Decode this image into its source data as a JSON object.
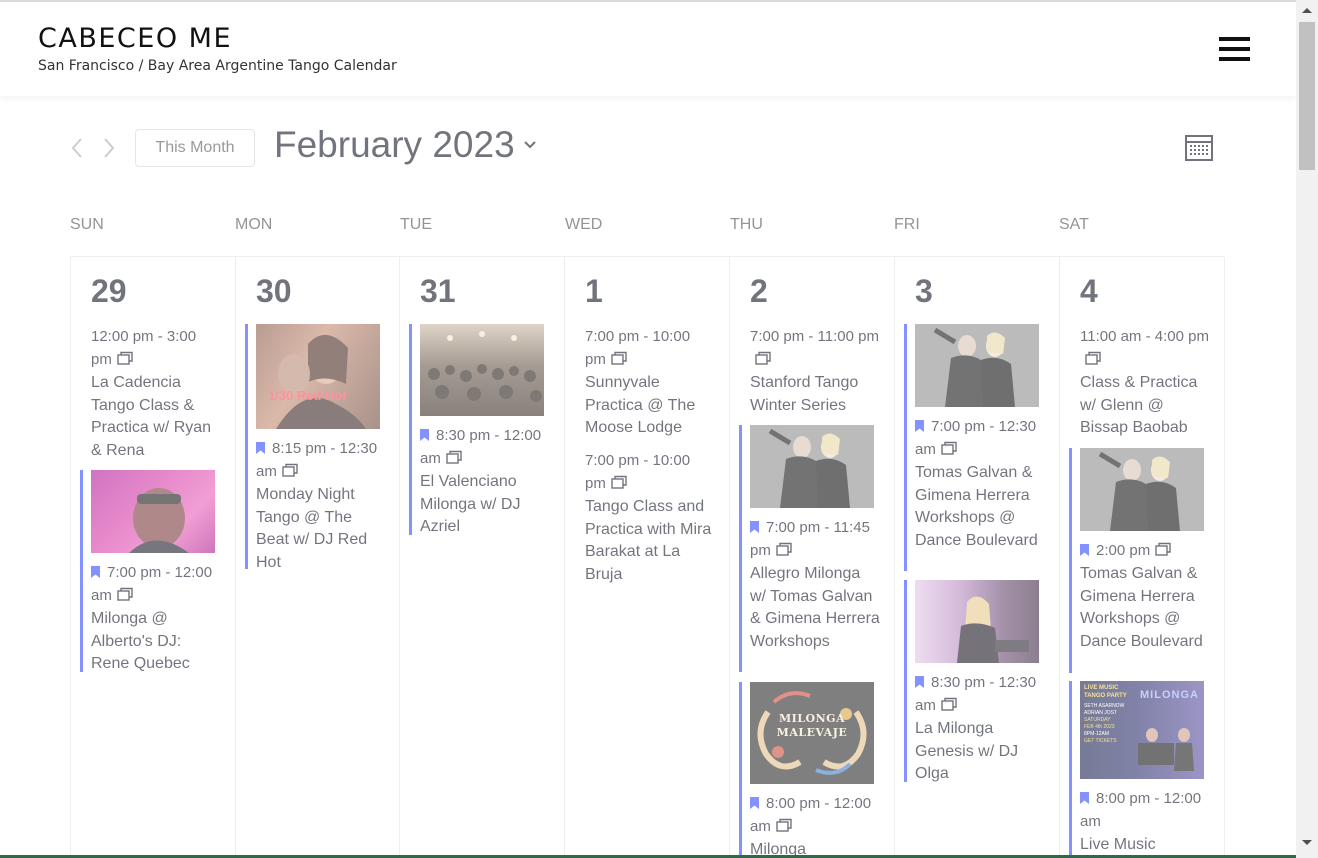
{
  "header": {
    "title": "CABECEO ME",
    "tagline": "San Francisco / Bay Area Argentine Tango Calendar"
  },
  "toolbar": {
    "today_label": "This Month",
    "month_label": "February 2023"
  },
  "weekdays": [
    "SUN",
    "MON",
    "TUE",
    "WED",
    "THU",
    "FRI",
    "SAT"
  ],
  "colors": {
    "accent": "#334aff",
    "text": "#141827",
    "border": "#e4e4e4"
  },
  "days": [
    {
      "num": "29",
      "events": [
        {
          "time": "12:00 pm - 3:00 pm",
          "title": "La Cadencia Tango Class & Practica w/ Ryan & Rena",
          "featured": false
        },
        {
          "time": "7:00 pm - 12:00 am",
          "title": "Milonga @ Alberto's DJ: Rene Quebec",
          "featured": true
        }
      ]
    },
    {
      "num": "30",
      "events": [
        {
          "time": "8:15 pm - 12:30 am",
          "title": "Monday Night Tango @ The Beat w/ DJ Red Hot",
          "featured": true,
          "img_caption": "1/30 Red Hot"
        }
      ]
    },
    {
      "num": "31",
      "events": [
        {
          "time": "8:30 pm - 12:00 am",
          "title": "El Valenciano Milonga w/ DJ Azriel",
          "featured": true
        }
      ]
    },
    {
      "num": "1",
      "events": [
        {
          "time": "7:00 pm - 10:00 pm",
          "title": "Sunnyvale Practica @ The Moose Lodge",
          "featured": false
        },
        {
          "time": "7:00 pm - 10:00 pm",
          "title": "Tango Class and Practica with Mira Barakat at La Bruja",
          "featured": false
        }
      ]
    },
    {
      "num": "2",
      "events": [
        {
          "time": "7:00 pm - 11:00 pm",
          "title": "Stanford Tango Winter Series",
          "featured": false
        },
        {
          "time": "7:00 pm - 11:45 pm",
          "title": "Allegro Milonga w/ Tomas Galvan & Gimena Herrera Workshops",
          "featured": true
        },
        {
          "time": "8:00 pm - 12:00 am",
          "title": "Milonga",
          "featured": true,
          "img_caption": "MILONGA MALEVAJE"
        }
      ]
    },
    {
      "num": "3",
      "events": [
        {
          "time": "7:00 pm - 12:30 am",
          "title": "Tomas Galvan & Gimena Herrera Workshops @ Dance Boulevard",
          "featured": true
        },
        {
          "time": "8:30 pm - 12:30 am",
          "title": "La Milonga Genesis w/ DJ Olga",
          "featured": true
        }
      ]
    },
    {
      "num": "4",
      "events": [
        {
          "time": "11:00 am - 4:00 pm",
          "title": "Class & Practica w/ Glenn @ Bissap Baobab",
          "featured": false
        },
        {
          "time": "2:00 pm",
          "title": "Tomas Galvan & Gimena Herrera Workshops @ Dance Boulevard",
          "featured": true
        },
        {
          "time": "8:00 pm - 12:00 am",
          "title": "Live Music",
          "featured": true,
          "img_caption": "LIVE MUSIC TANGO PARTY",
          "img_sub": [
            "SETH ASARNOW",
            "ADRIAN JOST",
            "SATURDAY",
            "FEB 4th 2023",
            "8PM-12AM",
            "GET TICKETS"
          ],
          "img_word": "MILONGA"
        }
      ]
    }
  ]
}
